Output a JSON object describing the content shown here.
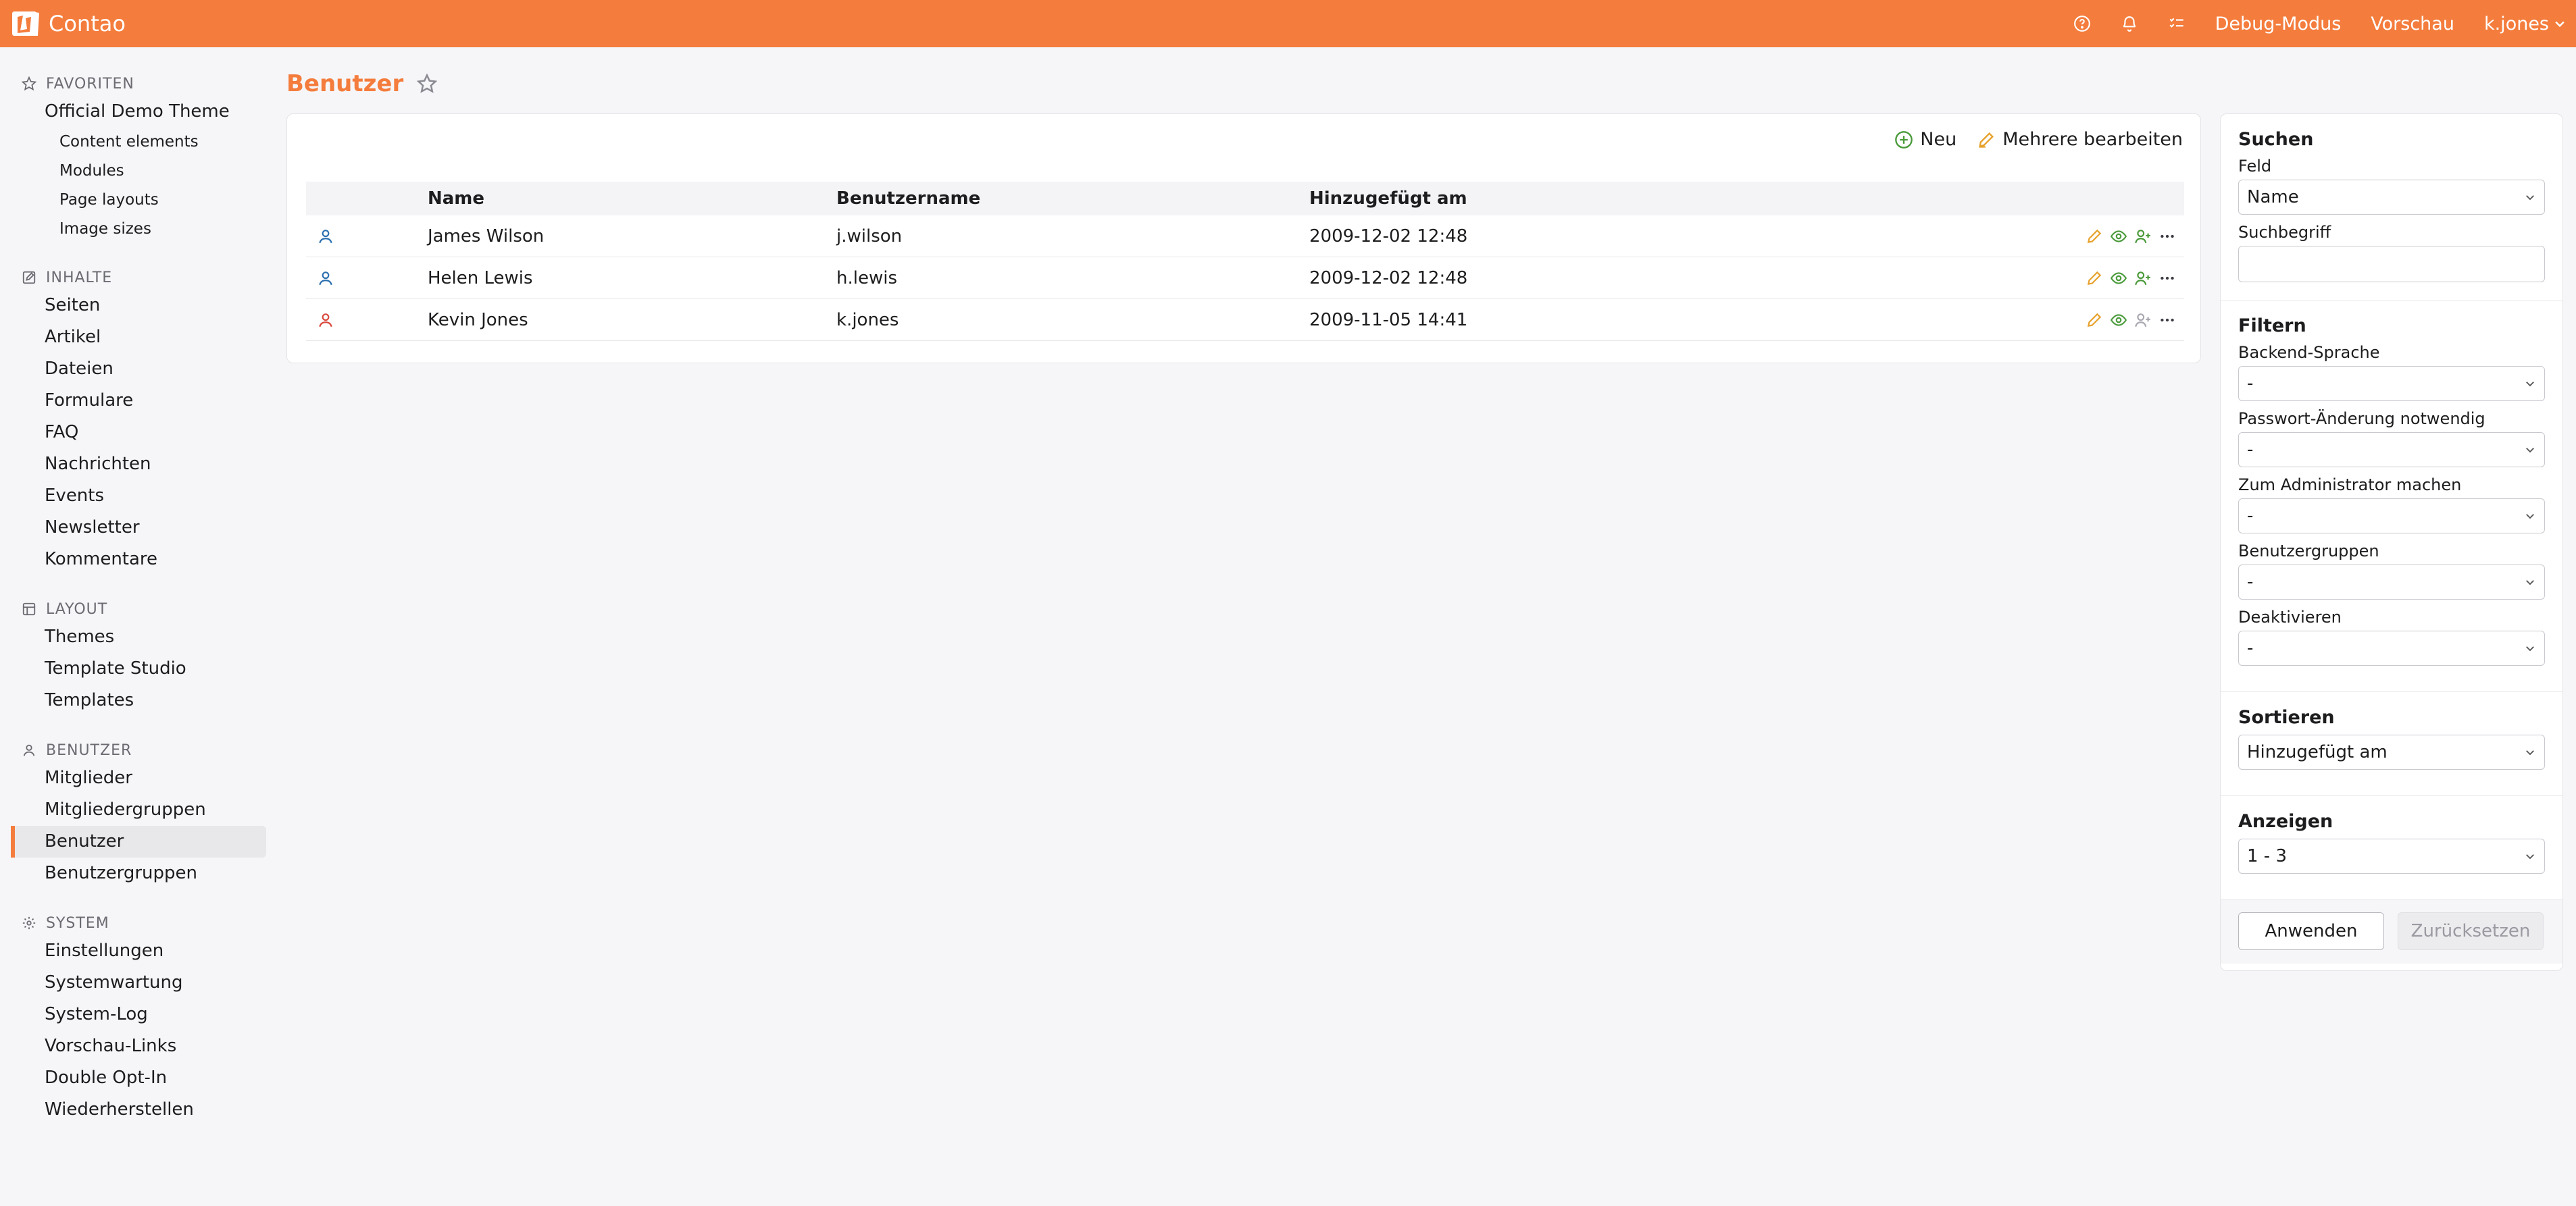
{
  "app": {
    "name": "Contao",
    "brand_color": "#f47c3c"
  },
  "topbar": {
    "icons": [
      "help-icon",
      "bell-icon",
      "tasks-icon"
    ],
    "debug_label": "Debug-Modus",
    "preview_label": "Vorschau",
    "user_label": "k.jones"
  },
  "sidebar": {
    "groups": [
      {
        "title": "FAVORITEN",
        "icon": "star-icon",
        "items": [
          {
            "label": "Official Demo Theme"
          },
          {
            "label": "Content elements",
            "sub": true
          },
          {
            "label": "Modules",
            "sub": true
          },
          {
            "label": "Page layouts",
            "sub": true
          },
          {
            "label": "Image sizes",
            "sub": true
          }
        ]
      },
      {
        "title": "INHALTE",
        "icon": "edit-icon",
        "items": [
          {
            "label": "Seiten"
          },
          {
            "label": "Artikel"
          },
          {
            "label": "Dateien"
          },
          {
            "label": "Formulare"
          },
          {
            "label": "FAQ"
          },
          {
            "label": "Nachrichten"
          },
          {
            "label": "Events"
          },
          {
            "label": "Newsletter"
          },
          {
            "label": "Kommentare"
          }
        ]
      },
      {
        "title": "LAYOUT",
        "icon": "layout-icon",
        "items": [
          {
            "label": "Themes"
          },
          {
            "label": "Template Studio"
          },
          {
            "label": "Templates"
          }
        ]
      },
      {
        "title": "BENUTZER",
        "icon": "user-icon",
        "items": [
          {
            "label": "Mitglieder"
          },
          {
            "label": "Mitgliedergruppen"
          },
          {
            "label": "Benutzer",
            "active": true
          },
          {
            "label": "Benutzergruppen"
          }
        ]
      },
      {
        "title": "SYSTEM",
        "icon": "gear-icon",
        "items": [
          {
            "label": "Einstellungen"
          },
          {
            "label": "Systemwartung"
          },
          {
            "label": "System-Log"
          },
          {
            "label": "Vorschau-Links"
          },
          {
            "label": "Double Opt-In"
          },
          {
            "label": "Wiederherstellen"
          }
        ]
      }
    ]
  },
  "main": {
    "title": "Benutzer",
    "actions": {
      "new_label": "Neu",
      "edit_multiple_label": "Mehrere bearbeiten"
    },
    "table": {
      "headers": [
        "Name",
        "Benutzername",
        "Hinzugefügt am"
      ],
      "rows": [
        {
          "name": "James Wilson",
          "username": "j.wilson",
          "added": "2009-12-02 12:48",
          "status_color": "#2a6fb0"
        },
        {
          "name": "Helen Lewis",
          "username": "h.lewis",
          "added": "2009-12-02 12:48",
          "status_color": "#2a6fb0"
        },
        {
          "name": "Kevin Jones",
          "username": "k.jones",
          "added": "2009-11-05 14:41",
          "status_color": "#d9473c"
        }
      ]
    }
  },
  "panel": {
    "search": {
      "title": "Suchen",
      "field_label": "Feld",
      "field_value": "Name",
      "term_label": "Suchbegriff",
      "term_value": ""
    },
    "filter": {
      "title": "Filtern",
      "fields": [
        {
          "label": "Backend-Sprache",
          "value": "-"
        },
        {
          "label": "Passwort-Änderung notwendig",
          "value": "-"
        },
        {
          "label": "Zum Administrator machen",
          "value": "-"
        },
        {
          "label": "Benutzergruppen",
          "value": "-"
        },
        {
          "label": "Deaktivieren",
          "value": "-"
        }
      ]
    },
    "sort": {
      "title": "Sortieren",
      "value": "Hinzugefügt am"
    },
    "show": {
      "title": "Anzeigen",
      "value": "1 - 3"
    },
    "apply_label": "Anwenden",
    "reset_label": "Zurücksetzen"
  }
}
